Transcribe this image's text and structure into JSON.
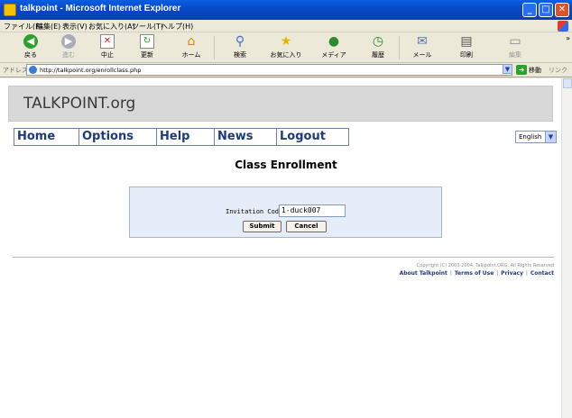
{
  "window": {
    "title": "talkpoint - Microsoft Internet Explorer"
  },
  "menu": {
    "items": [
      "ファイル(F)",
      "編集(E)",
      "表示(V)",
      "お気に入り(A)",
      "ツール(T)",
      "ヘルプ(H)"
    ]
  },
  "toolbar": {
    "back": "戻る",
    "forward": "進む",
    "stop": "中止",
    "refresh": "更新",
    "home": "ホーム",
    "search": "検索",
    "favorites": "お気に入り",
    "media": "メディア",
    "history": "履歴",
    "mail": "メール",
    "print": "印刷",
    "edit": "編集"
  },
  "address": {
    "label": "アドレス(D)",
    "url": "http://talkpoint.org/enrollclass.php",
    "go": "移動",
    "links": "リンク"
  },
  "site": {
    "brand": "TALKPOINT.org",
    "nav": [
      "Home",
      "Options",
      "Help",
      "News",
      "Logout"
    ],
    "language": "English"
  },
  "page": {
    "heading": "Class Enrollment",
    "code_label": "Invitation Code:",
    "code_value": "1-duck007",
    "submit": "Submit",
    "cancel": "Cancel"
  },
  "footer": {
    "copyright": "Copyright (C) 2003-2004, Talkpoint.ORG. All Rights Reserved",
    "links": [
      "About Talkpoint",
      "Terms of Use",
      "Privacy",
      "Contact"
    ]
  }
}
